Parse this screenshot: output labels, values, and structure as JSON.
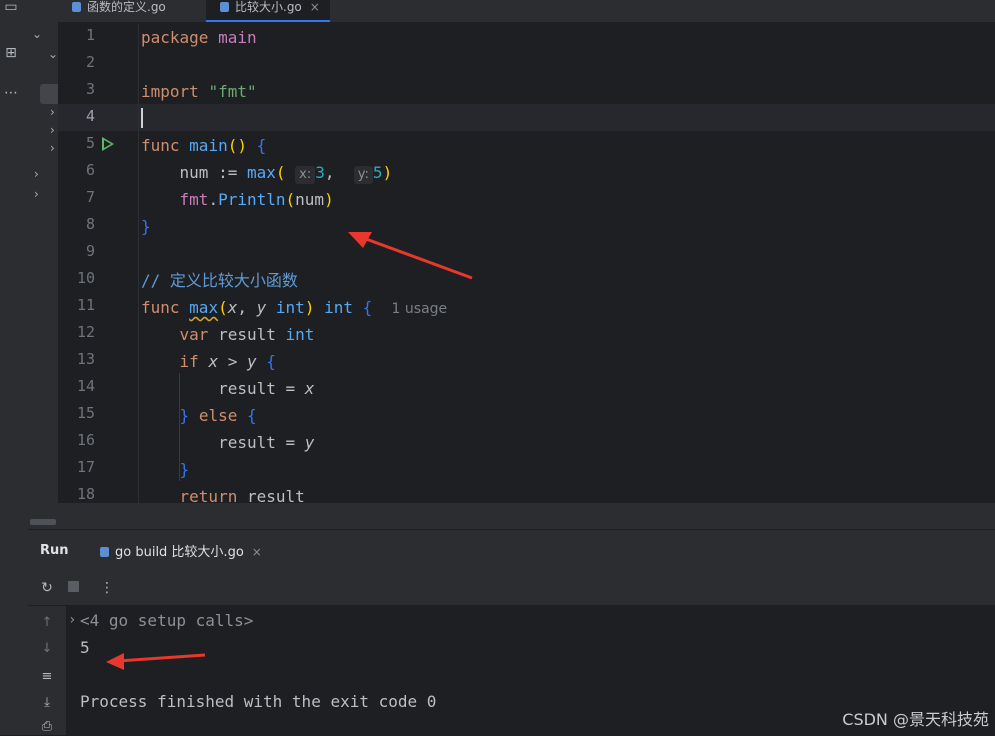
{
  "tabs": [
    {
      "label": "函数的定义.go",
      "active": false
    },
    {
      "label": "比较大小.go",
      "active": true
    }
  ],
  "editor": {
    "line_numbers": [
      "1",
      "2",
      "3",
      "4",
      "5",
      "6",
      "7",
      "8",
      "9",
      "10",
      "11",
      "12",
      "13",
      "14",
      "15",
      "16",
      "17",
      "18"
    ],
    "current_line": "4",
    "code": {
      "l1_kw": "package",
      "l1_name": "main",
      "l3_kw": "import",
      "l3_str": "\"fmt\"",
      "l5_kw": "func",
      "l5_name": "main",
      "l5_rest": "() {",
      "l6_var": "num",
      "l6_op": " := ",
      "l6_fn": "max",
      "l6_hint_x": "x:",
      "l6_arg1": "3",
      "l6_comma": ", ",
      "l6_hint_y": "y:",
      "l6_arg2": "5",
      "l7_pkg": "fmt",
      "l7_fn": "Println",
      "l7_arg": "num",
      "l8": "}",
      "l10": "// 定义比较大小函数",
      "l11_kw": "func",
      "l11_fn": "max",
      "l11_p1": "x",
      "l11_p2": "y",
      "l11_t1": "int",
      "l11_t2": "int",
      "l11_usage": "1 usage",
      "l12_kw": "var",
      "l12_name": "result",
      "l12_type": "int",
      "l13_kw": "if",
      "l13_x": "x",
      "l13_op": " > ",
      "l13_y": "y",
      "l14_name": "result",
      "l14_op": " = ",
      "l14_val": "x",
      "l15_kw": "else",
      "l16_name": "result",
      "l16_op": " = ",
      "l16_val": "y",
      "l17": "}",
      "l18_kw": "return",
      "l18_val": "result"
    }
  },
  "run_panel": {
    "title": "Run",
    "tab_label": "go build 比较大小.go",
    "console": {
      "setup": "<4 go setup calls>",
      "output": "5",
      "finished": "Process finished with the exit code 0"
    }
  },
  "watermark": "CSDN @景天科技苑",
  "colors": {
    "accent": "#3574f0",
    "background": "#1e1f22",
    "panel": "#2b2d30",
    "annotation_arrow": "#e8372c"
  }
}
